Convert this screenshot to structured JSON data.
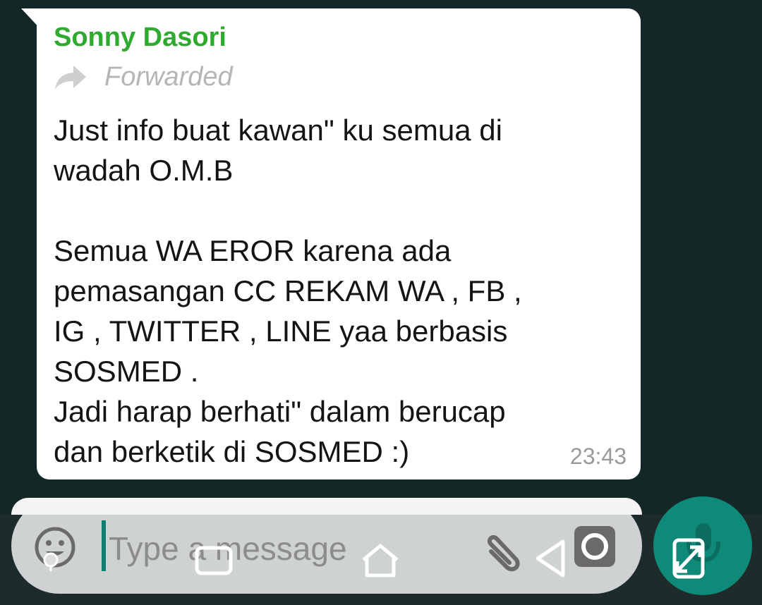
{
  "message": {
    "sender": "Sonny Dasori",
    "forwarded_label": "Forwarded",
    "lines": [
      "Just info buat kawan\" ku semua di",
      "wadah O.M.B",
      "",
      "Semua WA EROR karena ada",
      "pemasangan CC REKAM WA , FB ,",
      "IG , TWITTER , LINE yaa berbasis",
      "SOSMED .",
      "Jadi harap berhati\" dalam berucap",
      "dan berketik di SOSMED :)"
    ],
    "time": "23:43"
  },
  "composer": {
    "placeholder": "Type a message",
    "emoji_icon": "emoji-icon",
    "attach_icon": "paperclip-icon",
    "camera_icon": "camera-icon",
    "mic_icon": "microphone-icon"
  },
  "nav": {
    "recents_icon": "recents-icon",
    "home_icon": "home-icon",
    "back_icon": "back-icon",
    "rotate_icon": "rotate-screen-icon",
    "assist_icon": "assist-dot-icon"
  },
  "colors": {
    "sender": "#2eab2e",
    "accent": "#108a78",
    "bubble": "#ffffff",
    "background": "#142727"
  }
}
